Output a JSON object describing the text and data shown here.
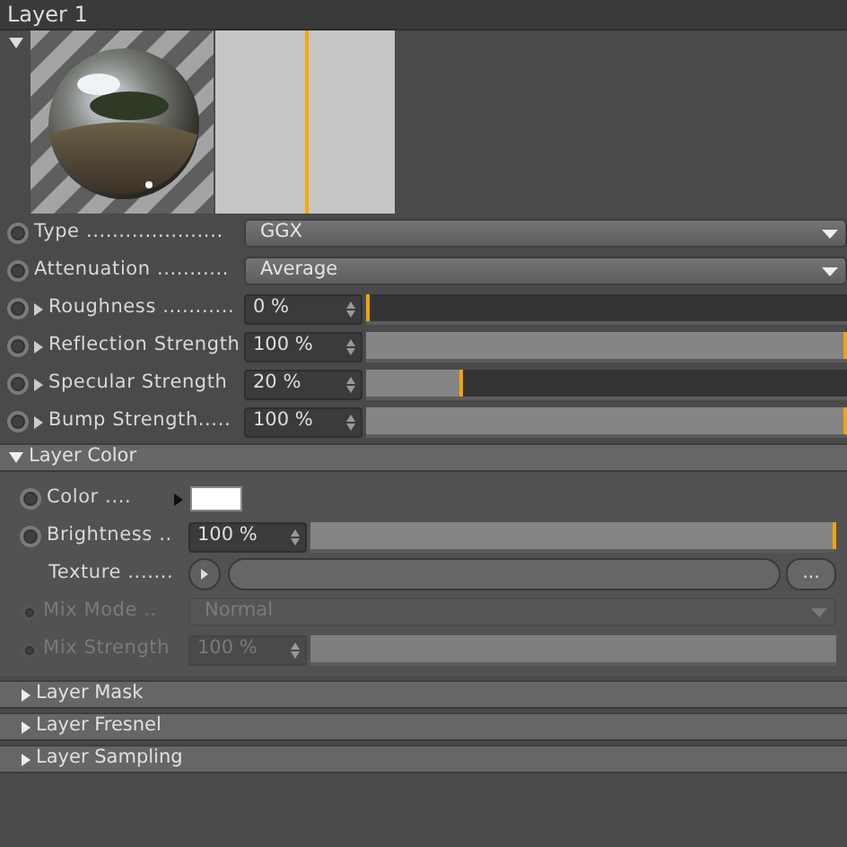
{
  "title": "Layer 1",
  "preview": {
    "expanded": true
  },
  "params": [
    {
      "kind": "dropdown",
      "label": "Type .....................",
      "value": "GGX",
      "expandable": false,
      "disabled": false
    },
    {
      "kind": "dropdown",
      "label": "Attenuation ...........",
      "value": "Average",
      "expandable": false,
      "disabled": false
    },
    {
      "kind": "slider",
      "label": "Roughness ...........",
      "value": "0 %",
      "level": 0,
      "expandable": true,
      "disabled": false
    },
    {
      "kind": "slider",
      "label": "Reflection Strength",
      "value": "100 %",
      "level": 1,
      "expandable": true,
      "disabled": false
    },
    {
      "kind": "slider",
      "label": "Specular Strength",
      "value": "20 %",
      "level": 0.2,
      "expandable": true,
      "disabled": false
    },
    {
      "kind": "slider",
      "label": "Bump Strength.....",
      "value": "100 %",
      "level": 1,
      "expandable": true,
      "disabled": false
    }
  ],
  "sections": [
    {
      "title": "Layer Color",
      "expanded": true,
      "params": [
        {
          "kind": "color",
          "label": "Color ....",
          "color": "#ffffff",
          "disabled": false
        },
        {
          "kind": "slider",
          "label": "Brightness ..",
          "value": "100 %",
          "level": 1,
          "disabled": false
        },
        {
          "kind": "texture",
          "label": "Texture .......",
          "more": "...",
          "disabled": false
        },
        {
          "kind": "dropdown",
          "label": "Mix Mode ..",
          "value": "Normal",
          "disabled": true
        },
        {
          "kind": "slider",
          "label": "Mix Strength",
          "value": "100 %",
          "level": 1,
          "disabled": true
        }
      ]
    },
    {
      "title": "Layer Mask",
      "expanded": false
    },
    {
      "title": "Layer Fresnel",
      "expanded": false
    },
    {
      "title": "Layer Sampling",
      "expanded": false
    }
  ]
}
